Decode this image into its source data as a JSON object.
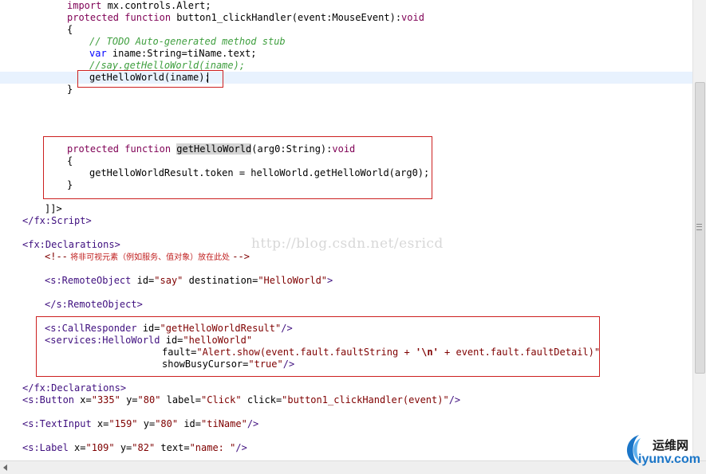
{
  "editor": {
    "lines": {
      "l1": {
        "kw": "import",
        "rest": " mx.controls.Alert;"
      },
      "l2": {
        "kw1": "protected",
        "kw2": "function",
        "rest": " button1_clickHandler(event:MouseEvent):",
        "ret": "void"
      },
      "l3": "{",
      "l4": "// TODO Auto-generated method stub",
      "l5": {
        "kw": "var",
        "rest": " iname:String=tiName.text;"
      },
      "l6": "//say.getHelloWorld(iname);",
      "l7": "getHelloWorld(iname);",
      "l8": "}",
      "l9": {
        "kw1": "protected",
        "kw2": "function",
        "name": "getHelloWorld",
        "rest": "(arg0:String):",
        "ret": "void"
      },
      "l10": "{",
      "l11": "getHelloWorldResult.token = helloWorld.getHelloWorld(arg0);",
      "l12": "}",
      "l13": "]]>",
      "l14": "</fx:Script>",
      "l15": "<fx:Declarations>",
      "l16": {
        "open": "<!--",
        "text": " 将非可视元素（例如服务、值对象）放在此处 ",
        "close": "-->"
      },
      "l17": {
        "tag": "<s:RemoteObject",
        "a1": " id=",
        "v1": "\"say\"",
        "a2": " destination=",
        "v2": "\"HelloWorld\"",
        "end": ">"
      },
      "l18": "</s:RemoteObject>",
      "l19": {
        "tag": "<s:CallResponder",
        "a1": " id=",
        "v1": "\"getHelloWorldResult\"",
        "end": "/>"
      },
      "l20": {
        "tag": "<services:HelloWorld",
        "a1": " id=",
        "v1": "\"helloWorld\""
      },
      "l21": {
        "a1": "fault=",
        "v1a": "\"Alert.show(event.fault.faultString + ",
        "v1b": "'\\n'",
        "v1c": " + event.fault.faultDetail)\""
      },
      "l22": {
        "a1": "showBusyCursor=",
        "v1": "\"true\"",
        "end": "/>"
      },
      "l23": "</fx:Declarations>",
      "l24": {
        "tag": "<s:Button",
        "a1": " x=",
        "v1": "\"335\"",
        "a2": " y=",
        "v2": "\"80\"",
        "a3": " label=",
        "v3": "\"Click\"",
        "a4": " click=",
        "v4": "\"button1_clickHandler(event)\"",
        "end": "/>"
      },
      "l25": {
        "tag": "<s:TextInput",
        "a1": " x=",
        "v1": "\"159\"",
        "a2": " y=",
        "v2": "\"80\"",
        "a3": " id=",
        "v3": "\"tiName\"",
        "end": "/>"
      },
      "l26": {
        "tag": "<s:Label",
        "a1": " x=",
        "v1": "\"109\"",
        "a2": " y=",
        "v2": "\"82\"",
        "a3": " text=",
        "v3": "\"name: \"",
        "end": "/>"
      }
    }
  },
  "watermark": "http://blog.csdn.net/esricd",
  "logo": {
    "line1": "运维网",
    "line2": "iyunv.com"
  },
  "colors": {
    "annotation_box": "#cc2020",
    "current_line": "#e8f2fe",
    "keyword": "#0000ff",
    "comment": "#3f9f3f"
  }
}
